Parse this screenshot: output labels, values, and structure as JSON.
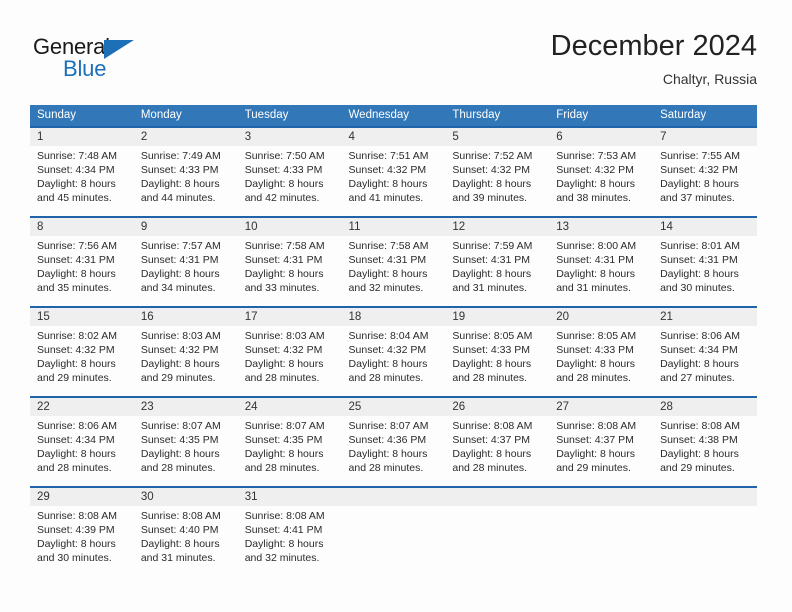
{
  "brand": {
    "name_primary": "General",
    "name_secondary": "Blue",
    "accent_color": "#1d70b8"
  },
  "header": {
    "title": "December 2024",
    "subtitle": "Chaltyr, Russia"
  },
  "calendar": {
    "header_bg": "#3277b8",
    "separator_color": "#1f63a8",
    "numrow_bg": "#efefef",
    "weekdays": [
      "Sunday",
      "Monday",
      "Tuesday",
      "Wednesday",
      "Thursday",
      "Friday",
      "Saturday"
    ],
    "weeks": [
      {
        "days": [
          {
            "num": "1",
            "sunrise": "Sunrise: 7:48 AM",
            "sunset": "Sunset: 4:34 PM",
            "daylight1": "Daylight: 8 hours",
            "daylight2": "and 45 minutes."
          },
          {
            "num": "2",
            "sunrise": "Sunrise: 7:49 AM",
            "sunset": "Sunset: 4:33 PM",
            "daylight1": "Daylight: 8 hours",
            "daylight2": "and 44 minutes."
          },
          {
            "num": "3",
            "sunrise": "Sunrise: 7:50 AM",
            "sunset": "Sunset: 4:33 PM",
            "daylight1": "Daylight: 8 hours",
            "daylight2": "and 42 minutes."
          },
          {
            "num": "4",
            "sunrise": "Sunrise: 7:51 AM",
            "sunset": "Sunset: 4:32 PM",
            "daylight1": "Daylight: 8 hours",
            "daylight2": "and 41 minutes."
          },
          {
            "num": "5",
            "sunrise": "Sunrise: 7:52 AM",
            "sunset": "Sunset: 4:32 PM",
            "daylight1": "Daylight: 8 hours",
            "daylight2": "and 39 minutes."
          },
          {
            "num": "6",
            "sunrise": "Sunrise: 7:53 AM",
            "sunset": "Sunset: 4:32 PM",
            "daylight1": "Daylight: 8 hours",
            "daylight2": "and 38 minutes."
          },
          {
            "num": "7",
            "sunrise": "Sunrise: 7:55 AM",
            "sunset": "Sunset: 4:32 PM",
            "daylight1": "Daylight: 8 hours",
            "daylight2": "and 37 minutes."
          }
        ]
      },
      {
        "days": [
          {
            "num": "8",
            "sunrise": "Sunrise: 7:56 AM",
            "sunset": "Sunset: 4:31 PM",
            "daylight1": "Daylight: 8 hours",
            "daylight2": "and 35 minutes."
          },
          {
            "num": "9",
            "sunrise": "Sunrise: 7:57 AM",
            "sunset": "Sunset: 4:31 PM",
            "daylight1": "Daylight: 8 hours",
            "daylight2": "and 34 minutes."
          },
          {
            "num": "10",
            "sunrise": "Sunrise: 7:58 AM",
            "sunset": "Sunset: 4:31 PM",
            "daylight1": "Daylight: 8 hours",
            "daylight2": "and 33 minutes."
          },
          {
            "num": "11",
            "sunrise": "Sunrise: 7:58 AM",
            "sunset": "Sunset: 4:31 PM",
            "daylight1": "Daylight: 8 hours",
            "daylight2": "and 32 minutes."
          },
          {
            "num": "12",
            "sunrise": "Sunrise: 7:59 AM",
            "sunset": "Sunset: 4:31 PM",
            "daylight1": "Daylight: 8 hours",
            "daylight2": "and 31 minutes."
          },
          {
            "num": "13",
            "sunrise": "Sunrise: 8:00 AM",
            "sunset": "Sunset: 4:31 PM",
            "daylight1": "Daylight: 8 hours",
            "daylight2": "and 31 minutes."
          },
          {
            "num": "14",
            "sunrise": "Sunrise: 8:01 AM",
            "sunset": "Sunset: 4:31 PM",
            "daylight1": "Daylight: 8 hours",
            "daylight2": "and 30 minutes."
          }
        ]
      },
      {
        "days": [
          {
            "num": "15",
            "sunrise": "Sunrise: 8:02 AM",
            "sunset": "Sunset: 4:32 PM",
            "daylight1": "Daylight: 8 hours",
            "daylight2": "and 29 minutes."
          },
          {
            "num": "16",
            "sunrise": "Sunrise: 8:03 AM",
            "sunset": "Sunset: 4:32 PM",
            "daylight1": "Daylight: 8 hours",
            "daylight2": "and 29 minutes."
          },
          {
            "num": "17",
            "sunrise": "Sunrise: 8:03 AM",
            "sunset": "Sunset: 4:32 PM",
            "daylight1": "Daylight: 8 hours",
            "daylight2": "and 28 minutes."
          },
          {
            "num": "18",
            "sunrise": "Sunrise: 8:04 AM",
            "sunset": "Sunset: 4:32 PM",
            "daylight1": "Daylight: 8 hours",
            "daylight2": "and 28 minutes."
          },
          {
            "num": "19",
            "sunrise": "Sunrise: 8:05 AM",
            "sunset": "Sunset: 4:33 PM",
            "daylight1": "Daylight: 8 hours",
            "daylight2": "and 28 minutes."
          },
          {
            "num": "20",
            "sunrise": "Sunrise: 8:05 AM",
            "sunset": "Sunset: 4:33 PM",
            "daylight1": "Daylight: 8 hours",
            "daylight2": "and 28 minutes."
          },
          {
            "num": "21",
            "sunrise": "Sunrise: 8:06 AM",
            "sunset": "Sunset: 4:34 PM",
            "daylight1": "Daylight: 8 hours",
            "daylight2": "and 27 minutes."
          }
        ]
      },
      {
        "days": [
          {
            "num": "22",
            "sunrise": "Sunrise: 8:06 AM",
            "sunset": "Sunset: 4:34 PM",
            "daylight1": "Daylight: 8 hours",
            "daylight2": "and 28 minutes."
          },
          {
            "num": "23",
            "sunrise": "Sunrise: 8:07 AM",
            "sunset": "Sunset: 4:35 PM",
            "daylight1": "Daylight: 8 hours",
            "daylight2": "and 28 minutes."
          },
          {
            "num": "24",
            "sunrise": "Sunrise: 8:07 AM",
            "sunset": "Sunset: 4:35 PM",
            "daylight1": "Daylight: 8 hours",
            "daylight2": "and 28 minutes."
          },
          {
            "num": "25",
            "sunrise": "Sunrise: 8:07 AM",
            "sunset": "Sunset: 4:36 PM",
            "daylight1": "Daylight: 8 hours",
            "daylight2": "and 28 minutes."
          },
          {
            "num": "26",
            "sunrise": "Sunrise: 8:08 AM",
            "sunset": "Sunset: 4:37 PM",
            "daylight1": "Daylight: 8 hours",
            "daylight2": "and 28 minutes."
          },
          {
            "num": "27",
            "sunrise": "Sunrise: 8:08 AM",
            "sunset": "Sunset: 4:37 PM",
            "daylight1": "Daylight: 8 hours",
            "daylight2": "and 29 minutes."
          },
          {
            "num": "28",
            "sunrise": "Sunrise: 8:08 AM",
            "sunset": "Sunset: 4:38 PM",
            "daylight1": "Daylight: 8 hours",
            "daylight2": "and 29 minutes."
          }
        ]
      },
      {
        "days": [
          {
            "num": "29",
            "sunrise": "Sunrise: 8:08 AM",
            "sunset": "Sunset: 4:39 PM",
            "daylight1": "Daylight: 8 hours",
            "daylight2": "and 30 minutes."
          },
          {
            "num": "30",
            "sunrise": "Sunrise: 8:08 AM",
            "sunset": "Sunset: 4:40 PM",
            "daylight1": "Daylight: 8 hours",
            "daylight2": "and 31 minutes."
          },
          {
            "num": "31",
            "sunrise": "Sunrise: 8:08 AM",
            "sunset": "Sunset: 4:41 PM",
            "daylight1": "Daylight: 8 hours",
            "daylight2": "and 32 minutes."
          },
          {
            "num": "",
            "sunrise": "",
            "sunset": "",
            "daylight1": "",
            "daylight2": ""
          },
          {
            "num": "",
            "sunrise": "",
            "sunset": "",
            "daylight1": "",
            "daylight2": ""
          },
          {
            "num": "",
            "sunrise": "",
            "sunset": "",
            "daylight1": "",
            "daylight2": ""
          },
          {
            "num": "",
            "sunrise": "",
            "sunset": "",
            "daylight1": "",
            "daylight2": ""
          }
        ]
      }
    ]
  }
}
